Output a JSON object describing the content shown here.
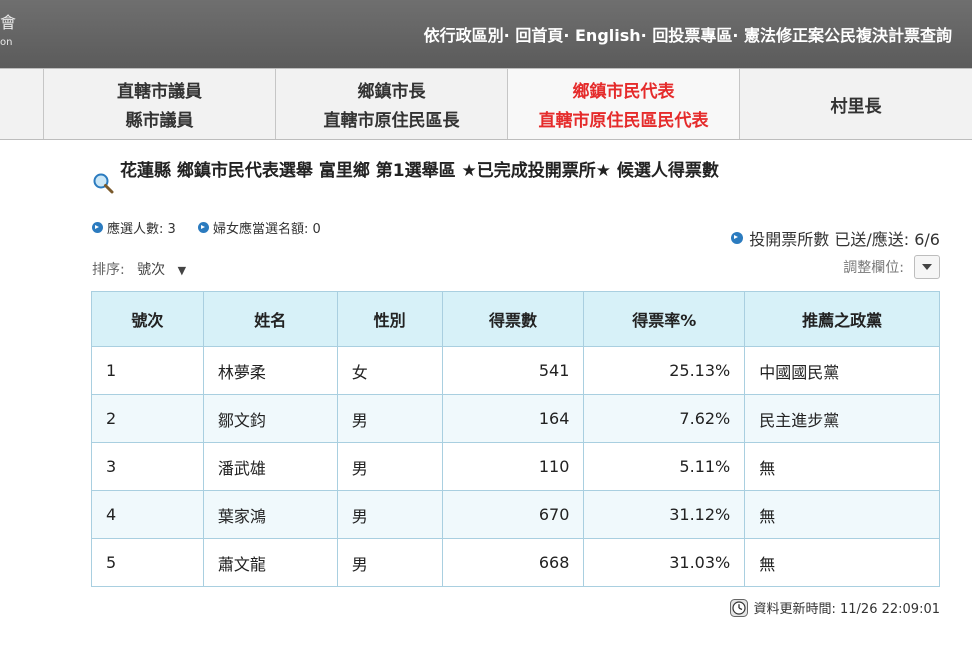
{
  "brand": {
    "glyph": "會",
    "tail": "on"
  },
  "topnav": {
    "items": [
      "依行政區別·",
      "回首頁·",
      "English·",
      "回投票專區·",
      "憲法修正案公民複決計票查詢"
    ]
  },
  "tabs": [
    {
      "line1": "直轄市議員",
      "line2": "縣市議員",
      "active": false
    },
    {
      "line1": "鄉鎮市長",
      "line2": "直轄市原住民區長",
      "active": false
    },
    {
      "line1": "鄉鎮市民代表",
      "line2": "直轄市原住民區民代表",
      "active": true
    },
    {
      "line1": "村里長",
      "line2": "",
      "active": false
    }
  ],
  "page": {
    "title": "花蓮縣 鄉鎮市民代表選舉 富里鄉 第1選舉區 ★已完成投開票所★ 候選人得票數",
    "elected_count_label": "應選人數: 3",
    "women_quota_label": "婦女應當選名額: 0",
    "polling_label": "投開票所數 已送/應送: 6/6",
    "sort_label": "排序:",
    "sort_value": "號次",
    "adjust_label": "調整欄位:",
    "updated_label": "資料更新時間: 11/26 22:09:01"
  },
  "table": {
    "headers": [
      "號次",
      "姓名",
      "性別",
      "得票數",
      "得票率%",
      "推薦之政黨"
    ],
    "rows": [
      [
        "1",
        "林夢柔",
        "女",
        "541",
        "25.13%",
        "中國國民黨"
      ],
      [
        "2",
        "鄒文鈞",
        "男",
        "164",
        "7.62%",
        "民主進步黨"
      ],
      [
        "3",
        "潘武雄",
        "男",
        "110",
        "5.11%",
        "無"
      ],
      [
        "4",
        "葉家鴻",
        "男",
        "670",
        "31.12%",
        "無"
      ],
      [
        "5",
        "蕭文龍",
        "男",
        "668",
        "31.03%",
        "無"
      ]
    ]
  },
  "colors": {
    "header_bg": "#666666",
    "active_tab": "#e52b2b",
    "table_header": "#d7f1f8",
    "accent_blue": "#2b7bbf"
  },
  "icons": [
    "search-icon",
    "bullet-icon",
    "dropdown-caret-icon",
    "clock-icon"
  ]
}
